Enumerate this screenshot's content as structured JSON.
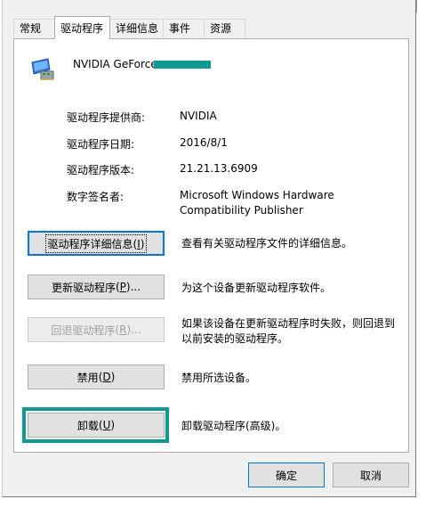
{
  "tabs": [
    {
      "label": "常规"
    },
    {
      "label": "驱动程序"
    },
    {
      "label": "详细信息"
    },
    {
      "label": "事件"
    },
    {
      "label": "资源"
    }
  ],
  "active_tab": "驱动程序",
  "device": {
    "name": "NVIDIA GeForce",
    "icon": "display-adapter-icon"
  },
  "info": {
    "provider_label": "驱动程序提供商:",
    "provider_value": "NVIDIA",
    "date_label": "驱动程序日期:",
    "date_value": "2016/8/1",
    "version_label": "驱动程序版本:",
    "version_value": "21.21.13.6909",
    "signer_label": "数字签名者:",
    "signer_line1": "Microsoft Windows Hardware",
    "signer_line2": "Compatibility Publisher"
  },
  "actions": {
    "details": {
      "label": "驱动程序详细信息",
      "key": "I",
      "desc": "查看有关驱动程序文件的详细信息。"
    },
    "update": {
      "label": "更新驱动程序",
      "key": "P",
      "suffix": "...",
      "desc": "为这个设备更新驱动程序软件。"
    },
    "rollback": {
      "label": "回退驱动程序",
      "key": "R",
      "suffix": "...",
      "desc_line1": "如果该设备在更新驱动程序时失败，则回退到",
      "desc_line2": "以前安装的驱动程序。"
    },
    "disable": {
      "label": "禁用",
      "key": "D",
      "desc": "禁用所选设备。"
    },
    "uninstall": {
      "label": "卸载",
      "key": "U",
      "desc": "卸载驱动程序(高级)。"
    }
  },
  "footer": {
    "ok": "确定",
    "cancel": "取消"
  },
  "colors": {
    "highlight": "#0e9a92",
    "focus": "#0078d7"
  }
}
